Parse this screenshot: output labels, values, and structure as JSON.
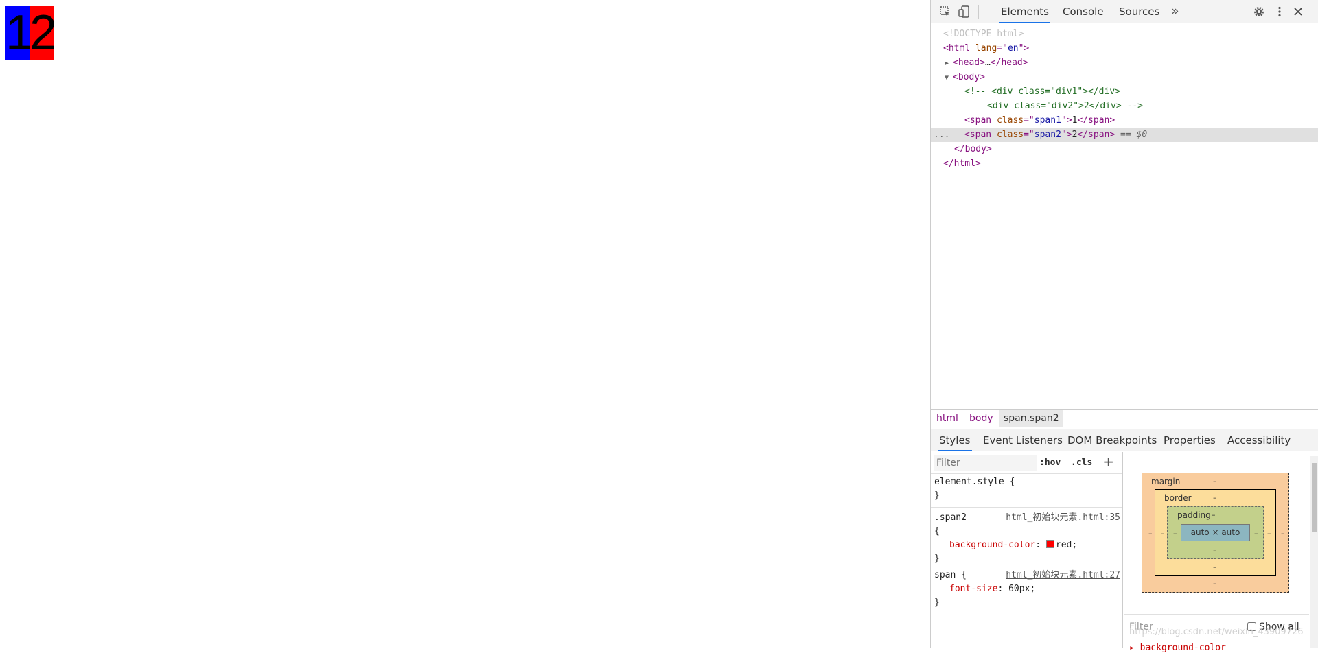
{
  "demo": {
    "span1_text": "1",
    "span2_text": "2",
    "span1_color": "#0000ff",
    "span2_color": "#ff0000"
  },
  "devtools": {
    "tabs": [
      "Elements",
      "Console",
      "Sources"
    ],
    "more_tabs": "»",
    "icons": [
      "inspect-icon",
      "device-toggle-icon",
      "settings-icon",
      "kebab-menu-icon",
      "close-icon"
    ],
    "dom": {
      "doctype": "<!DOCTYPE html>",
      "html_open_tag": "html",
      "lang_attr": "lang",
      "lang_val": "en",
      "head": "head",
      "head_ellipsis": "…",
      "body": "body",
      "comment_line1_prefix": "<!-- ",
      "comment_line1": "<div class=\"div1\"></div>",
      "comment_line2": "<div class=\"div2\">2</div> -->",
      "span1_class": "span1",
      "span1_text": "1",
      "span2_class": "span2",
      "span2_text": "2",
      "span_tag": "span",
      "class_attr": "class",
      "selected_suffix": "== $0",
      "more_dots": "..."
    },
    "breadcrumbs": [
      "html",
      "body",
      "span.span2"
    ],
    "subtabs": [
      "Styles",
      "Event Listeners",
      "DOM Breakpoints",
      "Properties",
      "Accessibility"
    ],
    "styles": {
      "filter_placeholder": "Filter",
      "hov": ":hov",
      "cls": ".cls",
      "plus": "+",
      "element_style": "element.style {",
      "close_brace": "}",
      "open_brace": "{",
      "rule1_selector": ".span2",
      "rule1_source": "html_初始块元素.html:35",
      "rule1_prop": "background-color",
      "rule1_value": "red;",
      "rule2_selector": "span {",
      "rule2_source": "html_初始块元素.html:27",
      "rule2_prop": "font-size",
      "rule2_value": "60px;"
    },
    "box_model": {
      "margin": "margin",
      "border": "border",
      "padding": "padding",
      "content": "auto × auto",
      "dash": "–",
      "filter_placeholder": "Filter",
      "show_all": "Show all",
      "watermark": "https://blog.csdn.net/weixin_43909726",
      "cut_prop": "▸ background-color"
    }
  }
}
